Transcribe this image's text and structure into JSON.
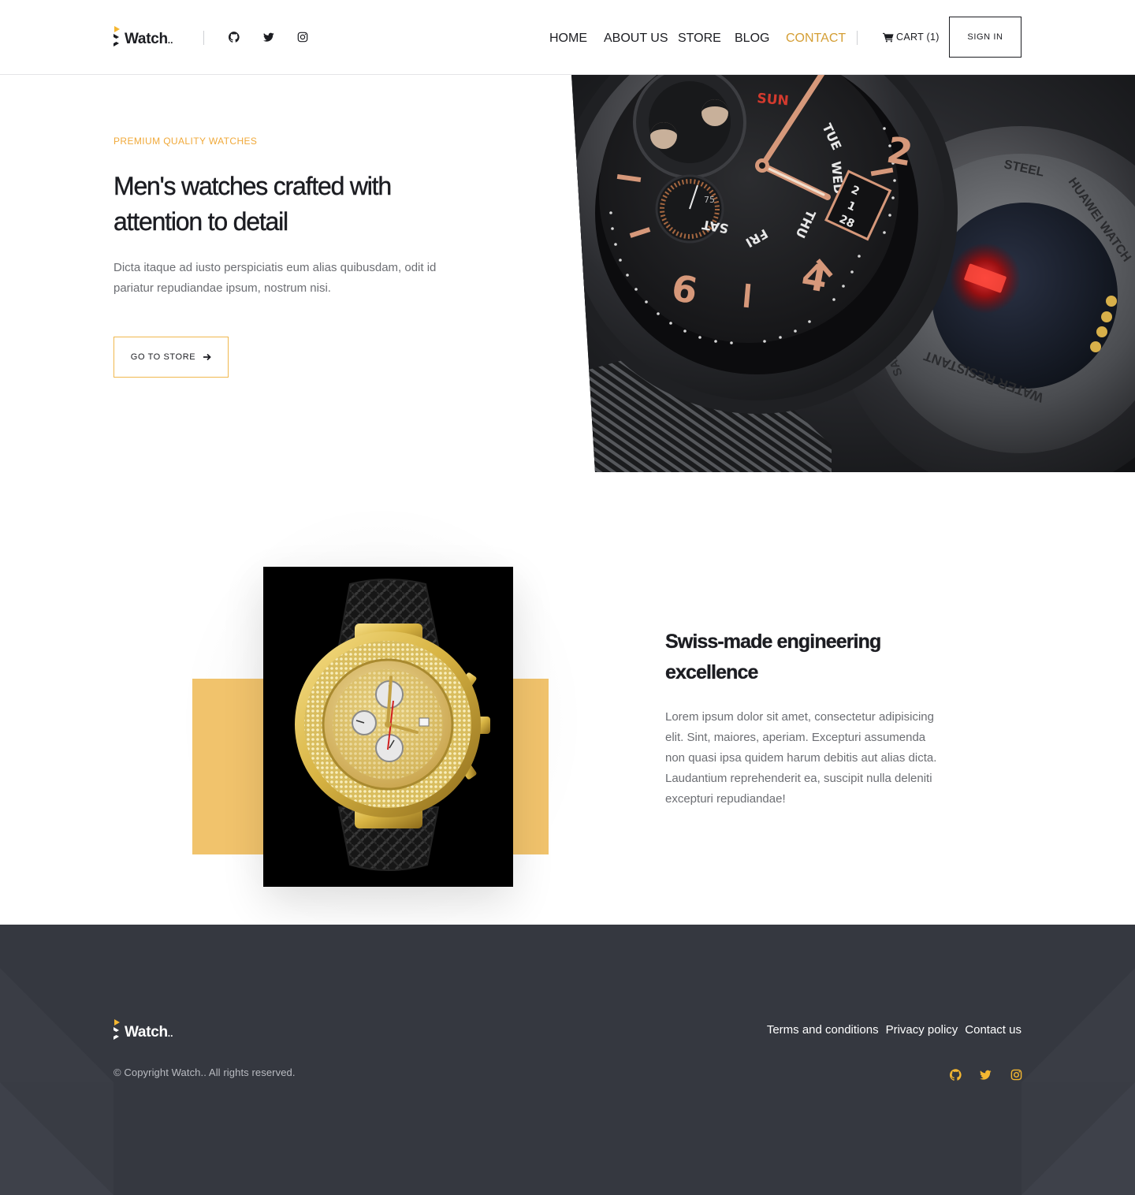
{
  "brand": {
    "name": "Watch",
    "dots": ".."
  },
  "header": {
    "social": [
      "github-icon",
      "twitter-icon",
      "instagram-icon"
    ],
    "nav": [
      {
        "label": "HOME",
        "active": false
      },
      {
        "label": "ABOUT US",
        "active": false
      },
      {
        "label": "STORE",
        "active": false
      },
      {
        "label": "BLOG",
        "active": false
      },
      {
        "label": "CONTACT",
        "active": true
      }
    ],
    "cart_label": "CART (1)",
    "cart_icon": "cart-icon",
    "signin_label": "SIGN IN"
  },
  "hero": {
    "eyebrow": "PREMIUM QUALITY WATCHES",
    "title_line1": "Men's watches crafted with",
    "title_line2": "attention to detail",
    "text": "Dicta itaque ad iusto perspiciatis eum alias quibusdam, odit id pariatur repudiandae ipsum, nostrum nisi.",
    "button_label": "GO TO STORE",
    "button_icon": "arrow-right-icon",
    "watch": {
      "day_label": "SUN",
      "weekdays": [
        "TUE",
        "WED",
        "THU",
        "FRI",
        "SAT"
      ],
      "date_digits": [
        "2",
        "1",
        "28"
      ],
      "numerals": [
        "2",
        "4",
        "6"
      ],
      "subdial_label": "75",
      "back_text": [
        "STEEL",
        "HUAWEI WATCH",
        "WATER RESISTANT",
        "SAPP"
      ]
    }
  },
  "feature": {
    "title_line1": "Swiss-made engineering",
    "title_line2": "excellence",
    "text": "Lorem ipsum dolor sit amet, consectetur adipisicing elit. Sint, maiores, aperiam. Excepturi assumenda non quasi ipsa quidem harum debitis aut alias dicta. Laudantium reprehenderit ea, suscipit nulla deleniti excepturi repudiandae!"
  },
  "footer": {
    "copyright": "© Copyright Watch.. All rights reserved.",
    "links": [
      "Terms and conditions",
      "Privacy policy",
      "Contact us"
    ],
    "social": [
      "github-icon",
      "twitter-icon",
      "instagram-icon"
    ]
  },
  "colors": {
    "accent": "#f0a93a",
    "nav_active": "#d49e34",
    "gold_block": "#f1c36c",
    "footer_bg": "#353840",
    "text_dark": "#1c1d22",
    "text_muted": "#6c6e73"
  }
}
